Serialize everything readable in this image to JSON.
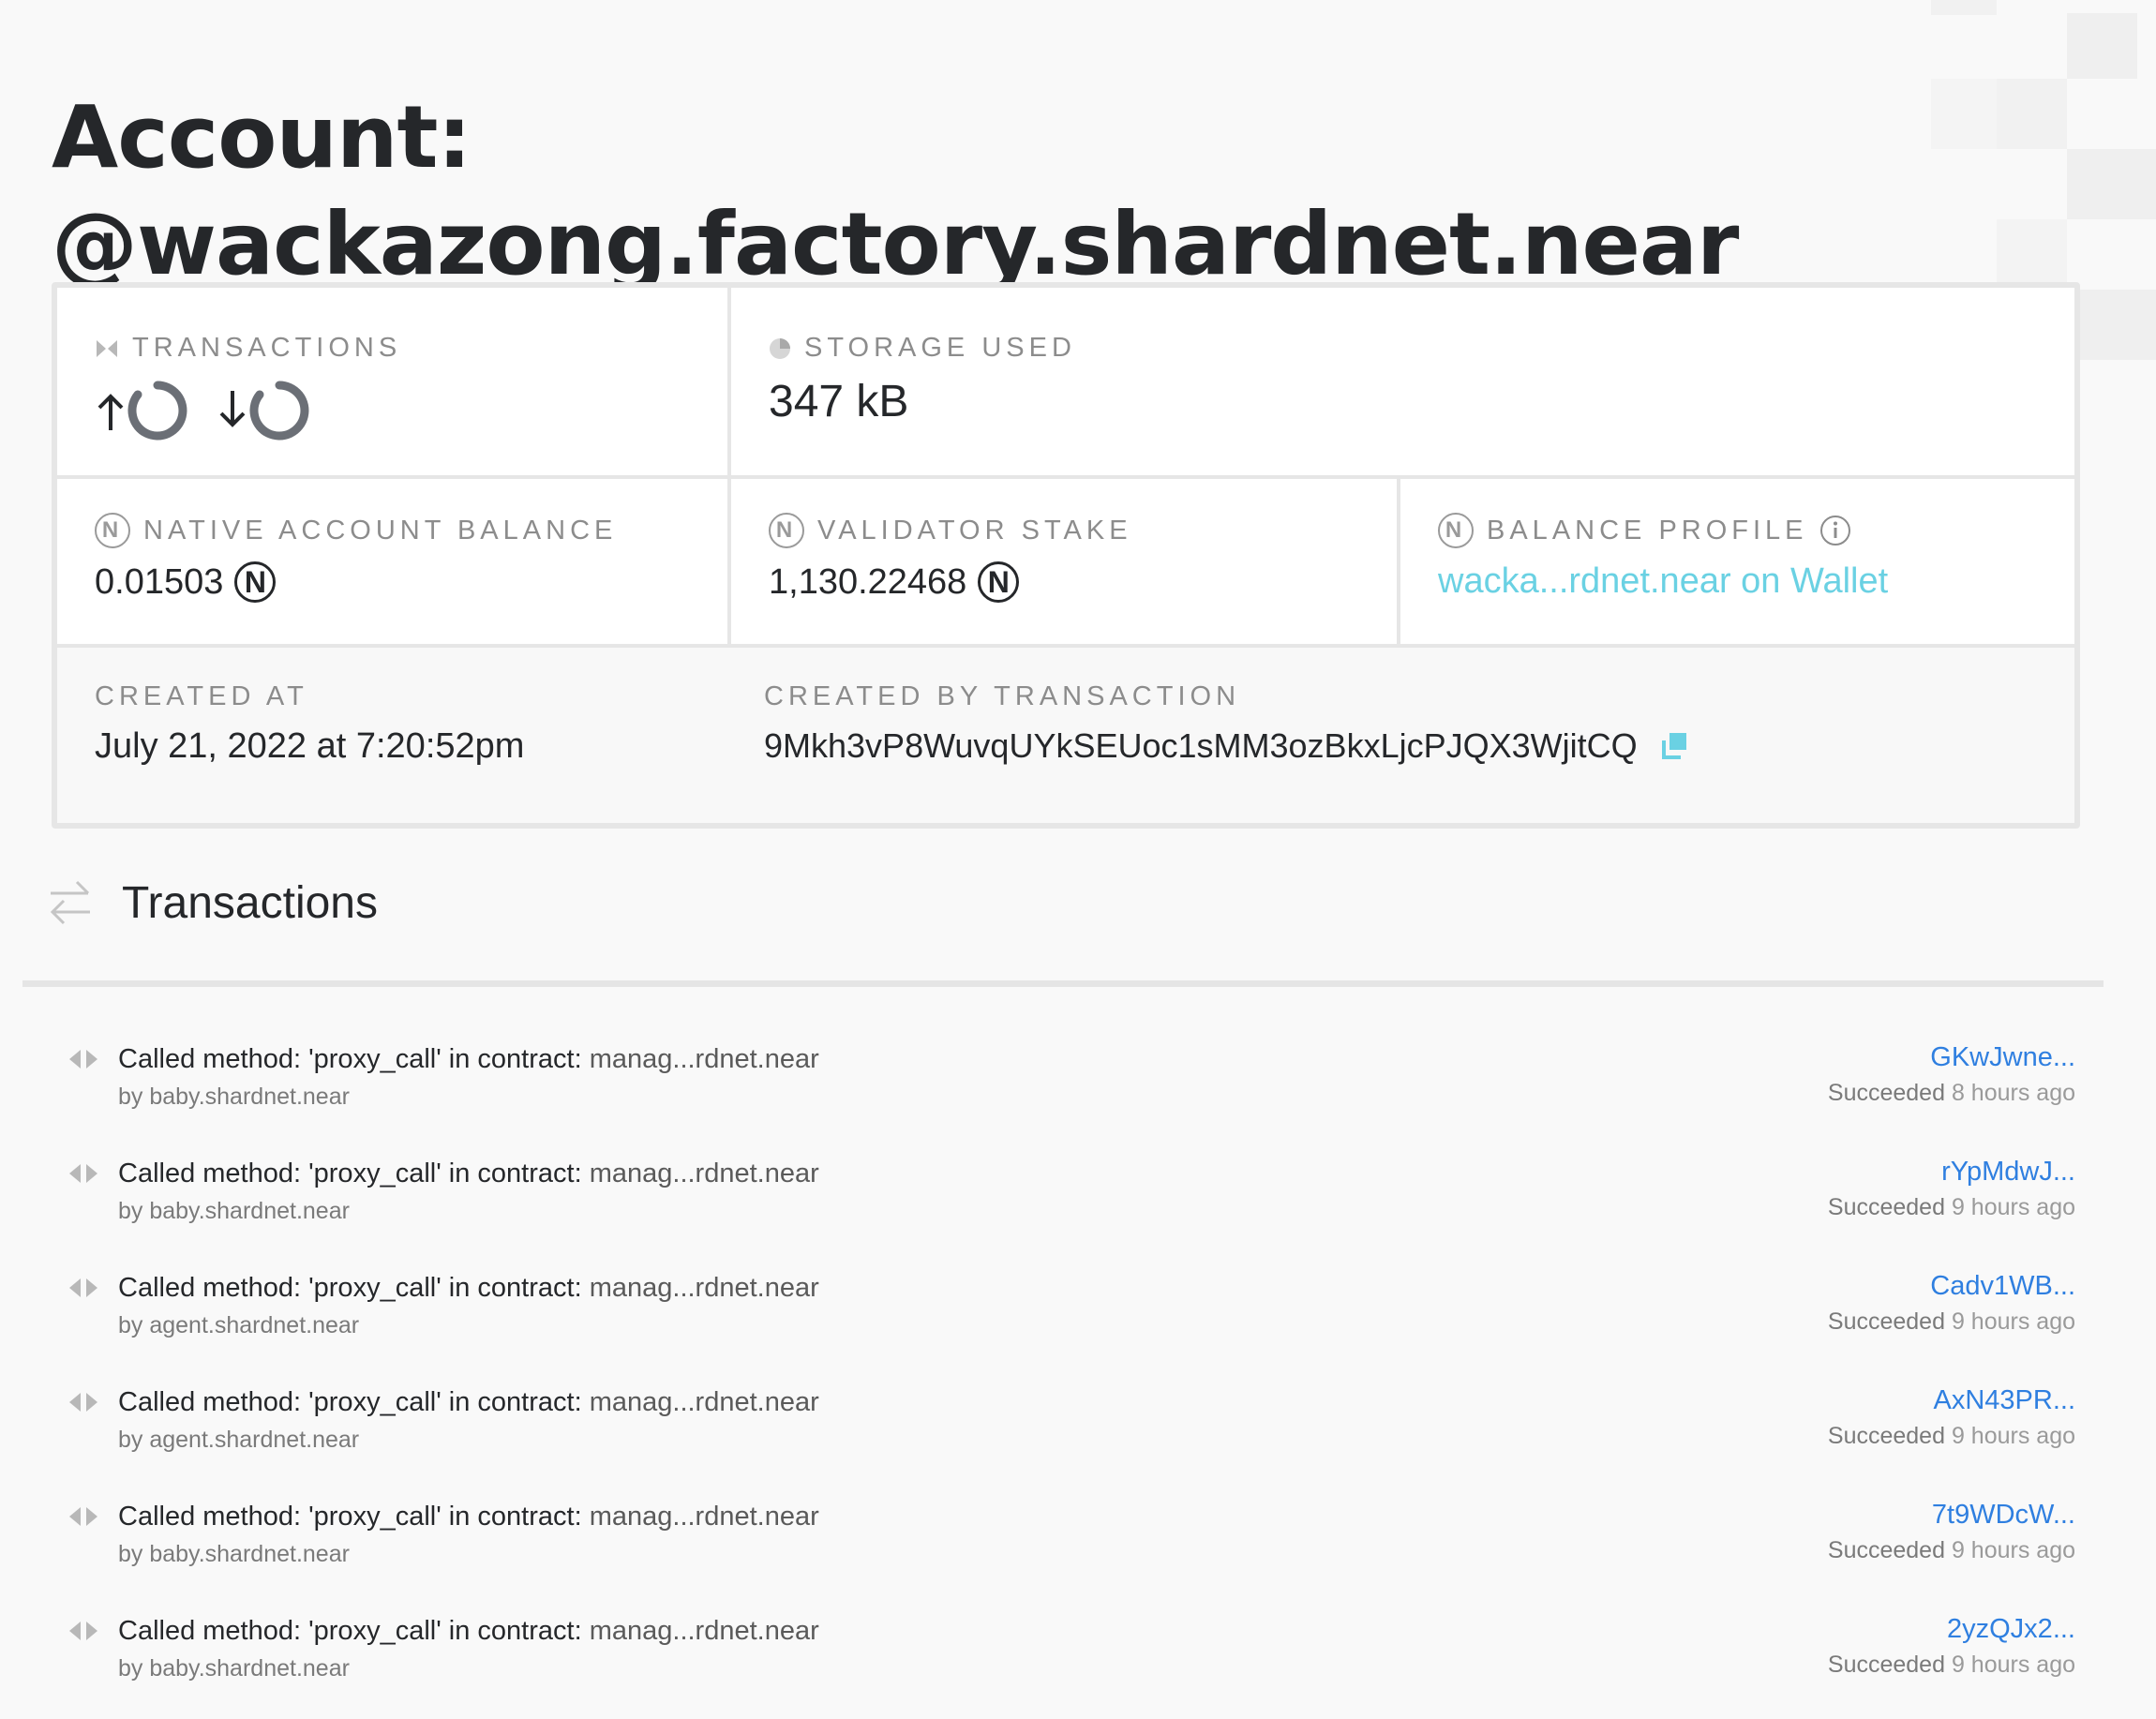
{
  "page": {
    "title_line1": "Account:",
    "title_line2": "@wackazong.factory.shardnet.near"
  },
  "account": {
    "transactions_label": "TRANSACTIONS",
    "storage_label": "STORAGE USED",
    "storage_value": "347 kB",
    "balance_label": "NATIVE ACCOUNT BALANCE",
    "balance_value": "0.01503",
    "stake_label": "VALIDATOR STAKE",
    "stake_value": "1,130.22468",
    "profile_label": "BALANCE PROFILE",
    "profile_link": "wacka...rdnet.near on Wallet",
    "created_at_label": "CREATED AT",
    "created_at_value": "July 21, 2022 at 7:20:52pm",
    "created_by_label": "CREATED BY TRANSACTION",
    "created_by_value": "9Mkh3vP8WuvqUYkSEUoc1sMM3ozBkxLjcPJQX3WjitCQ",
    "near_symbol": "N"
  },
  "transactions_section": {
    "title": "Transactions",
    "items": [
      {
        "desc": "Called method: 'proxy_call' in contract:",
        "contract": "manag...rdnet.near",
        "by": "by baby.shardnet.near",
        "hash": "GKwJwne...",
        "status": "Succeeded",
        "time": "8 hours ago"
      },
      {
        "desc": "Called method: 'proxy_call' in contract:",
        "contract": "manag...rdnet.near",
        "by": "by baby.shardnet.near",
        "hash": "rYpMdwJ...",
        "status": "Succeeded",
        "time": "9 hours ago"
      },
      {
        "desc": "Called method: 'proxy_call' in contract:",
        "contract": "manag...rdnet.near",
        "by": "by agent.shardnet.near",
        "hash": "Cadv1WB...",
        "status": "Succeeded",
        "time": "9 hours ago"
      },
      {
        "desc": "Called method: 'proxy_call' in contract:",
        "contract": "manag...rdnet.near",
        "by": "by agent.shardnet.near",
        "hash": "AxN43PR...",
        "status": "Succeeded",
        "time": "9 hours ago"
      },
      {
        "desc": "Called method: 'proxy_call' in contract:",
        "contract": "manag...rdnet.near",
        "by": "by baby.shardnet.near",
        "hash": "7t9WDcW...",
        "status": "Succeeded",
        "time": "9 hours ago"
      },
      {
        "desc": "Called method: 'proxy_call' in contract:",
        "contract": "manag...rdnet.near",
        "by": "by baby.shardnet.near",
        "hash": "2yzQJx2...",
        "status": "Succeeded",
        "time": "9 hours ago"
      }
    ]
  },
  "colors": {
    "link": "#2f7fe0",
    "wallet_link": "#6ad1e3",
    "label": "#8c8c8c",
    "text": "#25272a"
  },
  "icons": [
    "transactions-icon",
    "storage-pie-icon",
    "near-coin-icon",
    "info-icon",
    "copy-icon",
    "transfer-arrows-icon",
    "contract-call-icon",
    "arrow-up-icon",
    "arrow-down-icon",
    "loading-spinner-icon"
  ]
}
